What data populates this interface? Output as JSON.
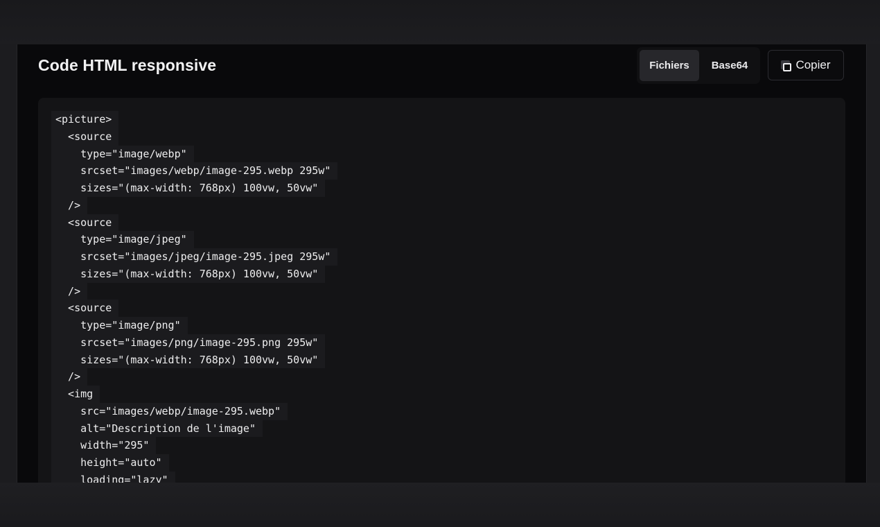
{
  "panel": {
    "title": "Code HTML responsive",
    "toggle": {
      "files_label": "Fichiers",
      "base64_label": "Base64",
      "active": "Fichiers"
    },
    "copy_label": "Copier",
    "copy_icon": "copy-icon"
  },
  "code": {
    "lines": [
      "<picture>",
      "  <source",
      "    type=\"image/webp\"",
      "    srcset=\"images/webp/image-295.webp 295w\"",
      "    sizes=\"(max-width: 768px) 100vw, 50vw\"",
      "  />",
      "  <source",
      "    type=\"image/jpeg\"",
      "    srcset=\"images/jpeg/image-295.jpeg 295w\"",
      "    sizes=\"(max-width: 768px) 100vw, 50vw\"",
      "  />",
      "  <source",
      "    type=\"image/png\"",
      "    srcset=\"images/png/image-295.png 295w\"",
      "    sizes=\"(max-width: 768px) 100vw, 50vw\"",
      "  />",
      "  <img",
      "    src=\"images/webp/image-295.webp\"",
      "    alt=\"Description de l'image\"",
      "    width=\"295\"",
      "    height=\"auto\"",
      "    loading=\"lazy\""
    ]
  },
  "colors": {
    "panel_bg": "#09090b",
    "code_bg": "#141416",
    "line_bg": "#1b1b1e",
    "text": "#eeeeef",
    "active_toggle": "#27272b"
  }
}
